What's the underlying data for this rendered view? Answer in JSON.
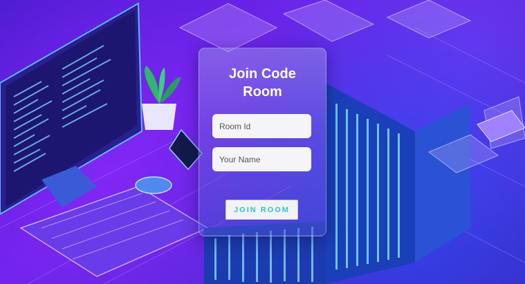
{
  "card": {
    "title": "Join Code Room",
    "room_id_placeholder": "Room Id",
    "name_placeholder": "Your Name",
    "join_button_label": "JOIN ROOM"
  },
  "colors": {
    "accent": "#2ec6c9",
    "background": "#5a1fd6"
  }
}
